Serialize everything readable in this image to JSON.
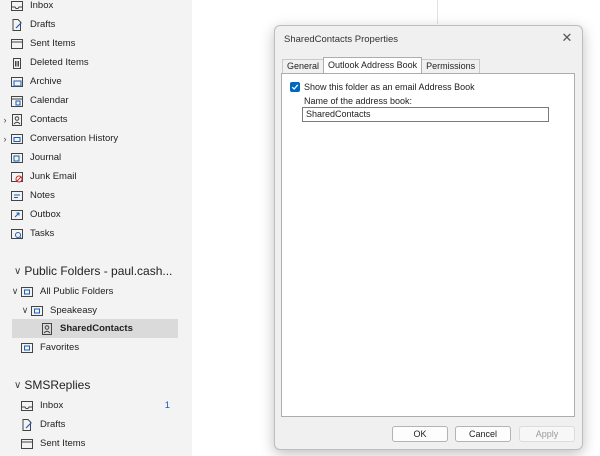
{
  "folders_top": [
    {
      "label": "Inbox",
      "icon": "inbox-icon"
    },
    {
      "label": "Drafts",
      "icon": "drafts-icon"
    },
    {
      "label": "Sent Items",
      "icon": "sent-items-icon"
    },
    {
      "label": "Deleted Items",
      "icon": "trash-icon"
    },
    {
      "label": "Archive",
      "icon": "archive-icon"
    },
    {
      "label": "Calendar",
      "icon": "calendar-icon"
    },
    {
      "label": "Contacts",
      "icon": "contacts-icon"
    },
    {
      "label": "Conversation History",
      "icon": "conversation-history-icon"
    },
    {
      "label": "Journal",
      "icon": "journal-icon"
    },
    {
      "label": "Junk Email",
      "icon": "junk-email-icon"
    },
    {
      "label": "Notes",
      "icon": "notes-icon"
    },
    {
      "label": "Outbox",
      "icon": "outbox-icon"
    },
    {
      "label": "Tasks",
      "icon": "tasks-icon"
    }
  ],
  "public_folders": {
    "header": "Public Folders - paul.cash...",
    "items": [
      {
        "label": "All Public Folders",
        "icon": "public-folder-icon"
      },
      {
        "label": "Speakeasy",
        "icon": "public-folder-icon"
      },
      {
        "label": "SharedContacts",
        "icon": "contacts-icon"
      },
      {
        "label": "Favorites",
        "icon": "public-folder-icon"
      }
    ]
  },
  "smsreplies": {
    "header": "SMSReplies",
    "items": [
      {
        "label": "Inbox",
        "icon": "inbox-icon",
        "count": "1"
      },
      {
        "label": "Drafts",
        "icon": "drafts-icon"
      },
      {
        "label": "Sent Items",
        "icon": "sent-items-icon"
      }
    ]
  },
  "dialog": {
    "title": "SharedContacts Properties",
    "close_glyph": "✕",
    "tabs": [
      "General",
      "Outlook Address Book",
      "Permissions"
    ],
    "active_tab": "Outlook Address Book",
    "checkbox_label": "Show this folder as an email Address Book",
    "checkbox_checked": true,
    "name_label": "Name of the address book:",
    "name_value": "SharedContacts",
    "ok_label": "OK",
    "cancel_label": "Cancel",
    "apply_label": "Apply"
  },
  "colors": {
    "accent": "#0067c0",
    "unread_count": "#1a5fb4",
    "selected_row": "#dadada",
    "pane_bg": "#f3f3f3",
    "dialog_bg": "#f0f0f0"
  }
}
